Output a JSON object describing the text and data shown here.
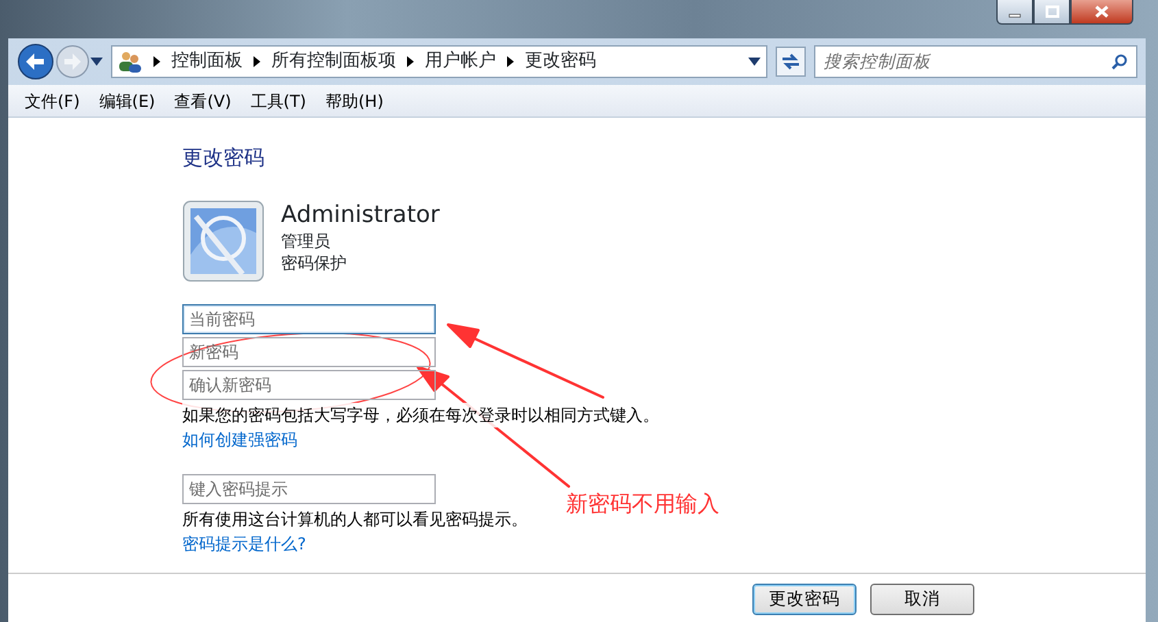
{
  "address_bar": {
    "breadcrumbs": [
      "控制面板",
      "所有控制面板项",
      "用户帐户",
      "更改密码"
    ]
  },
  "search": {
    "placeholder": "搜索控制面板"
  },
  "menu": [
    "文件(F)",
    "编辑(E)",
    "查看(V)",
    "工具(T)",
    "帮助(H)"
  ],
  "page": {
    "title": "更改密码",
    "user": {
      "name": "Administrator",
      "role": "管理员",
      "status": "密码保护"
    },
    "password_fields": [
      {
        "placeholder": "当前密码",
        "focused": true
      },
      {
        "placeholder": "新密码",
        "focused": false
      },
      {
        "placeholder": "确认新密码",
        "focused": false
      }
    ],
    "caps_note": "如果您的密码包括大写字母，必须在每次登录时以相同方式键入。",
    "strong_link": "如何创建强密码",
    "hint_field": {
      "placeholder": "键入密码提示"
    },
    "hint_note": "所有使用这台计算机的人都可以看见密码提示。",
    "hint_link": "密码提示是什么?"
  },
  "buttons": [
    {
      "label": "更改密码",
      "default": true
    },
    {
      "label": "取消",
      "default": false
    }
  ],
  "annotation": {
    "text": "新密码不用输入"
  }
}
